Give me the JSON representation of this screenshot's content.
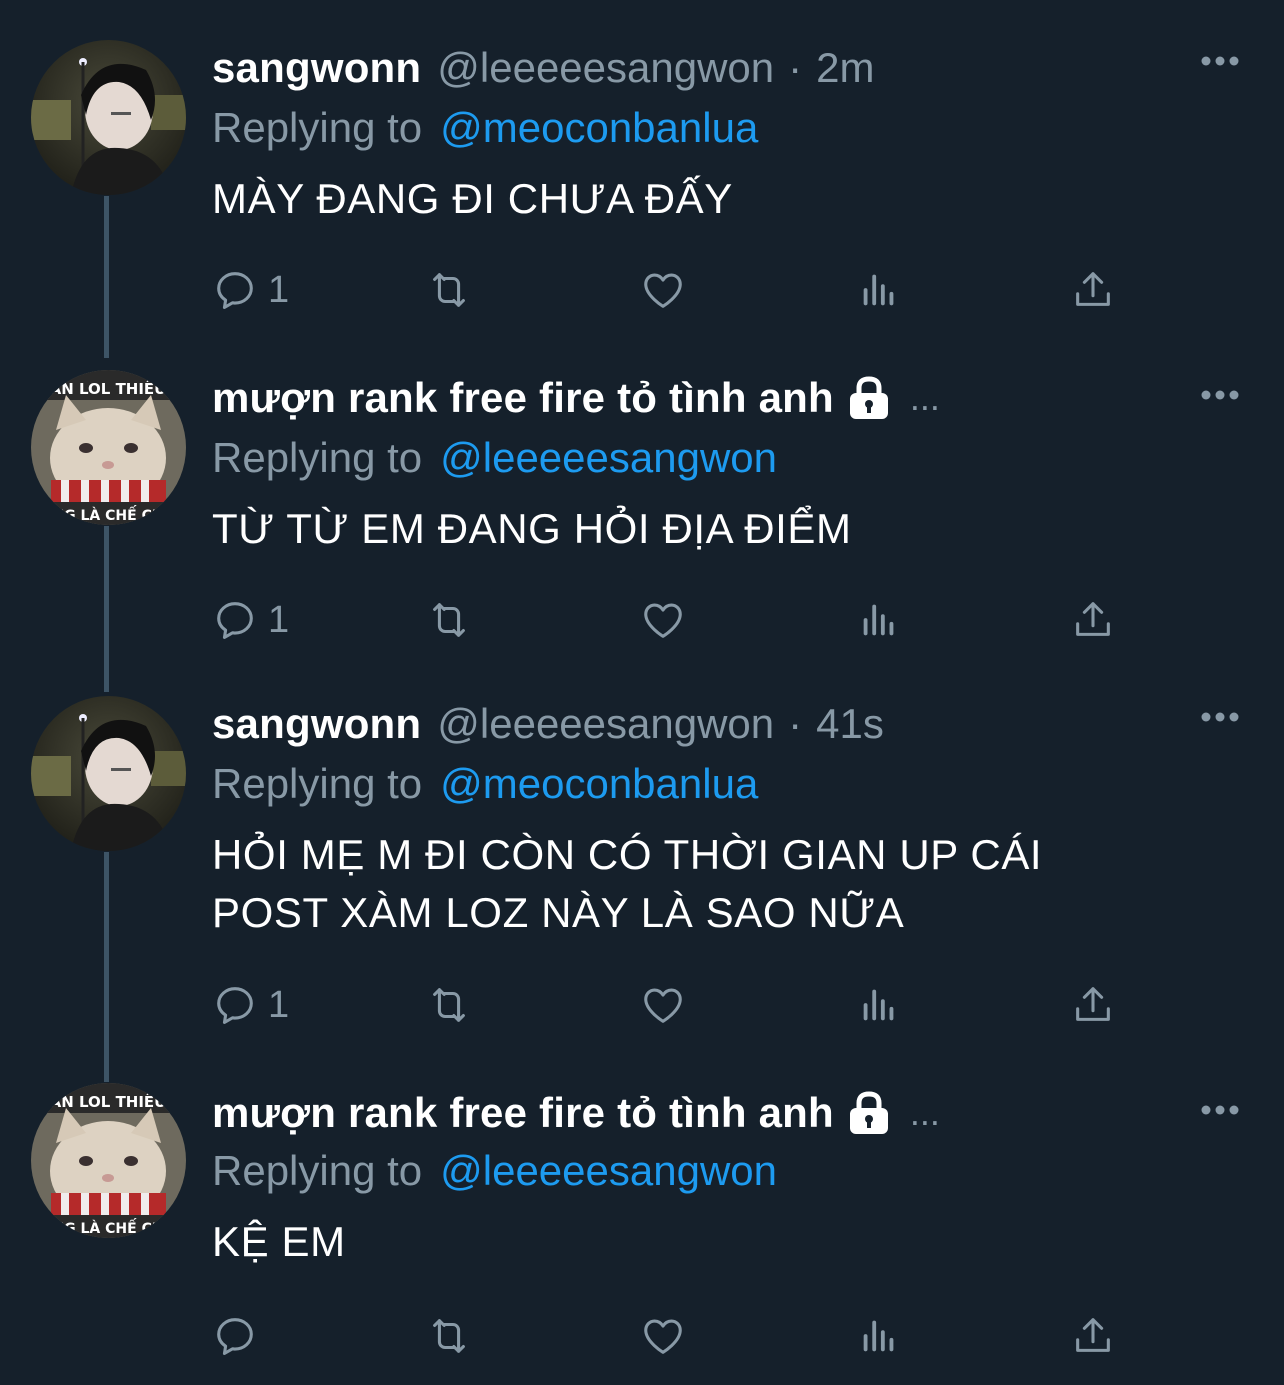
{
  "colors": {
    "background": "#15202b",
    "secondary_text": "#8899a6",
    "link": "#1d9bf0",
    "thread_line": "#3d5466"
  },
  "tweets": [
    {
      "display_name": "sangwonn",
      "handle": "@leeeeesangwon",
      "separator": "·",
      "time": "2m",
      "reply_prefix": "Replying to",
      "reply_to": "@meoconbanlua",
      "text": "MÀY ĐANG ĐI CHƯA ĐẤY",
      "reply_count": "1",
      "avatar": "person-avatar"
    },
    {
      "display_name": "mượn rank free fire tỏ tình anh",
      "truncation": "...",
      "reply_prefix": "Replying to",
      "reply_to": "@leeeeesangwon",
      "text": "TỪ TỪ EM ĐANG HỎI ĐỊA ĐIỂM",
      "reply_count": "1",
      "avatar": "cat-meme-avatar",
      "locked": true
    },
    {
      "display_name": "sangwonn",
      "handle": "@leeeeesangwon",
      "separator": "·",
      "time": "41s",
      "reply_prefix": "Replying to",
      "reply_to": "@meoconbanlua",
      "text_lines": [
        "HỎI MẸ M ĐI CÒN CÓ THỜI GIAN UP CÁI",
        "POST XÀM LOZ NÀY LÀ SAO NỮA"
      ],
      "reply_count": "1",
      "avatar": "person-avatar"
    },
    {
      "display_name": "mượn rank free fire tỏ tình anh",
      "truncation": "...",
      "reply_prefix": "Replying to",
      "reply_to": "@leeeeesangwon",
      "text": "KỆ EM",
      "reply_count": "",
      "avatar": "cat-meme-avatar",
      "locked": true
    }
  ],
  "avatar_caption": {
    "top": "ĂN LOL THIẾU",
    "bottom": "NG LÀ CHẾ CH"
  },
  "icons": [
    "reply-icon",
    "retweet-icon",
    "like-icon",
    "analytics-icon",
    "share-icon",
    "more-icon",
    "lock-icon"
  ]
}
